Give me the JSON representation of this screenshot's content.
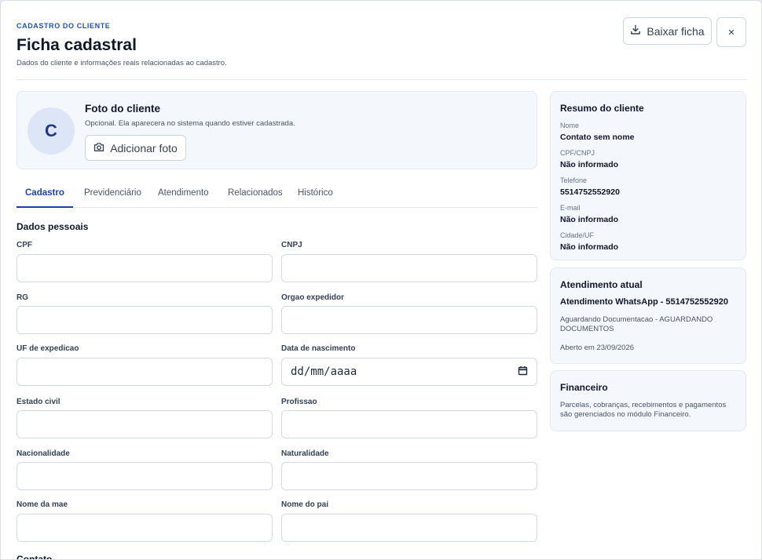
{
  "header": {
    "eyebrow": "CADASTRO DO CLIENTE",
    "title": "Ficha cadastral",
    "subtitle": "Dados do cliente e informações reais relacionadas ao cadastro.",
    "download_label": "Baixar ficha",
    "close_symbol": "×"
  },
  "photo": {
    "avatar_initial": "C",
    "title": "Foto do cliente",
    "description": "Opcional. Ela aparecera no sistema quando estiver cadastrada.",
    "button_label": "Adicionar foto"
  },
  "tabs": [
    {
      "label": "Cadastro",
      "active": true
    },
    {
      "label": "Previdenciário",
      "active": false
    },
    {
      "label": "Atendimento",
      "active": false
    },
    {
      "label": "Relacionados",
      "active": false
    },
    {
      "label": "Histórico",
      "active": false
    }
  ],
  "form": {
    "section_personal": "Dados pessoais",
    "section_contact": "Contato",
    "fields": {
      "cpf": {
        "label": "CPF",
        "value": ""
      },
      "cnpj": {
        "label": "CNPJ",
        "value": ""
      },
      "rg": {
        "label": "RG",
        "value": ""
      },
      "orgao": {
        "label": "Orgao expedidor",
        "value": ""
      },
      "uf": {
        "label": "UF de expedicao",
        "value": ""
      },
      "nascimento": {
        "label": "Data de nascimento",
        "placeholder": "dd/mm/aaaa"
      },
      "estado_civil": {
        "label": "Estado civil",
        "value": ""
      },
      "profissao": {
        "label": "Profissao",
        "value": ""
      },
      "nacionalidade": {
        "label": "Nacionalidade",
        "value": ""
      },
      "naturalidade": {
        "label": "Naturalidade",
        "value": ""
      },
      "mae": {
        "label": "Nome da mae",
        "value": ""
      },
      "pai": {
        "label": "Nome do pai",
        "value": ""
      }
    }
  },
  "summary": {
    "title": "Resumo do cliente",
    "items": [
      {
        "label": "Nome",
        "value": "Contato sem nome"
      },
      {
        "label": "CPF/CNPJ",
        "value": "Não informado"
      },
      {
        "label": "Telefone",
        "value": "5514752552920"
      },
      {
        "label": "E-mail",
        "value": "Não informado"
      },
      {
        "label": "Cidade/UF",
        "value": "Não informado"
      }
    ]
  },
  "attendance": {
    "title": "Atendimento atual",
    "name": "Atendimento WhatsApp - 5514752552920",
    "status": "Aguardando Documentacao - AGUARDANDO DOCUMENTOS",
    "opened": "Aberto em 23/09/2026"
  },
  "finance": {
    "title": "Financeiro",
    "description": "Parcelas, cobranças, recebimentos e pagamentos são gerenciados no módulo Financeiro."
  },
  "colors": {
    "accent": "#1e40af",
    "eyebrow": "#1d4ed8",
    "card_bg": "#f4f7fc",
    "border": "#e2e8f0"
  },
  "icons": [
    "download-icon",
    "close-icon",
    "camera-icon",
    "calendar-icon"
  ]
}
